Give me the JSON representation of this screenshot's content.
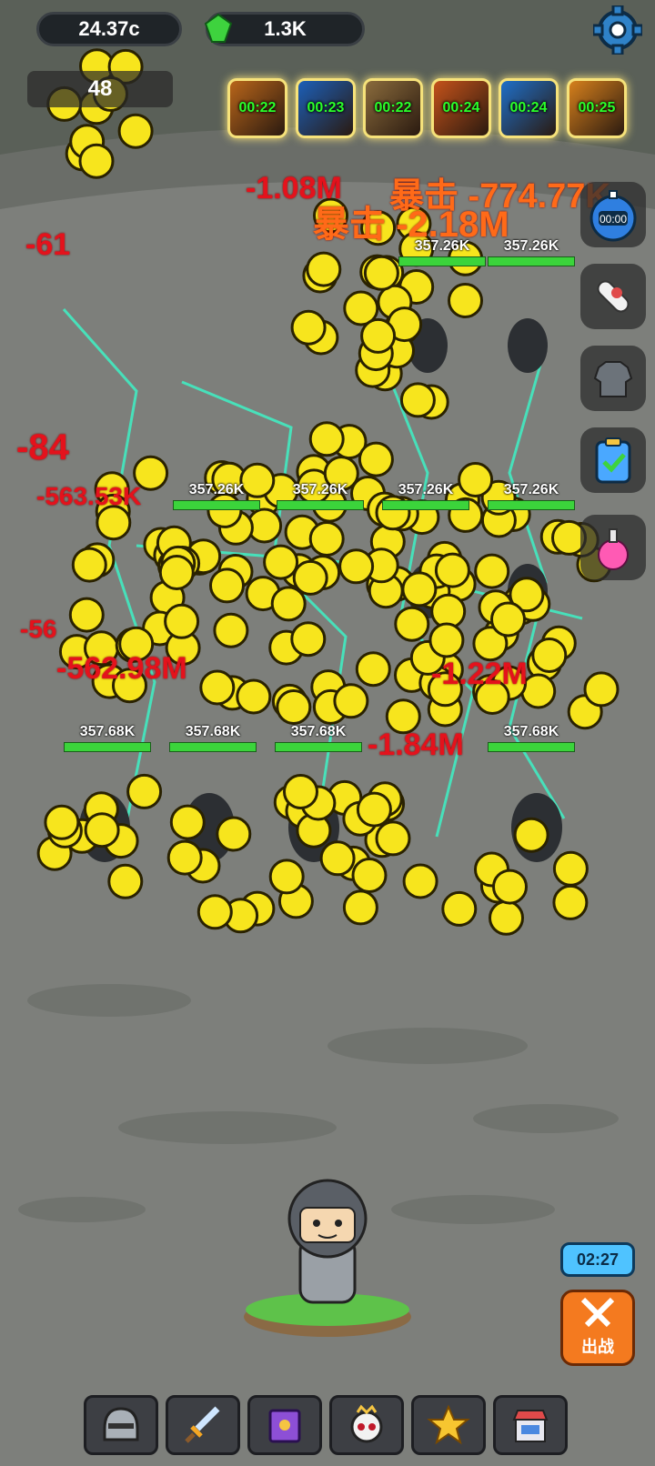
{
  "top_bar": {
    "coins": "24.37c",
    "gems": "1.3K",
    "level": "48"
  },
  "buffs": [
    {
      "timer": "00:22",
      "color": "#b8651a"
    },
    {
      "timer": "00:23",
      "color": "#1c5fb8"
    },
    {
      "timer": "00:22",
      "color": "#8a6b3c"
    },
    {
      "timer": "00:24",
      "color": "#c4521a"
    },
    {
      "timer": "00:24",
      "color": "#1f6fc8"
    },
    {
      "timer": "00:25",
      "color": "#d6801c"
    }
  ],
  "side_buttons": {
    "stopwatch": "00:00",
    "labels": [
      "stopwatch-icon",
      "scroll-icon",
      "armor-icon",
      "clipboard-icon",
      "potion-icon"
    ]
  },
  "enemies": {
    "row1_hp": [
      "357.26K",
      "357.26K"
    ],
    "row2_hp": [
      "357.26K",
      "357.26K",
      "357.26K",
      "357.26K"
    ],
    "row3_hp": [
      "357.68K",
      "357.68K",
      "357.68K",
      "357.68K"
    ]
  },
  "damage_numbers": [
    {
      "text": "暴击 -774.77K",
      "crit": true
    },
    {
      "text": "暴击 -2.18M",
      "crit": true
    },
    {
      "text": "-1.08M",
      "crit": false
    },
    {
      "text": "-84",
      "crit": false
    },
    {
      "text": "-563.53K",
      "crit": false
    },
    {
      "text": "-56",
      "crit": false
    },
    {
      "text": "-562.98M",
      "crit": false
    },
    {
      "text": "-1.22M",
      "crit": false
    },
    {
      "text": "-1.84M",
      "crit": false
    },
    {
      "text": "-61",
      "crit": false
    }
  ],
  "battle": {
    "countdown": "02:27",
    "button_label": "出战"
  },
  "nav": [
    "helmet-icon",
    "sword-icon",
    "spellbook-icon",
    "skull-icon",
    "star-icon",
    "shop-icon"
  ]
}
